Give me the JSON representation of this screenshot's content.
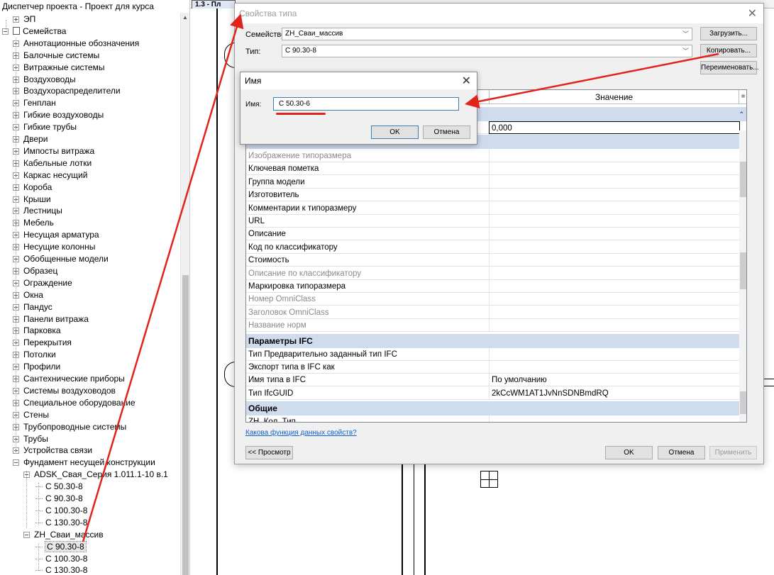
{
  "browser": {
    "title": "Диспетчер проекта - Проект для курса",
    "rows": [
      {
        "label": "ЭП",
        "indent": 18,
        "exp": "plus"
      },
      {
        "label": "Семейства",
        "indent": 3,
        "exp": "minus",
        "icon": true
      },
      {
        "label": "Аннотационные обозначения",
        "indent": 18,
        "exp": "plus"
      },
      {
        "label": "Балочные системы",
        "indent": 18,
        "exp": "plus"
      },
      {
        "label": "Витражные системы",
        "indent": 18,
        "exp": "plus"
      },
      {
        "label": "Воздуховоды",
        "indent": 18,
        "exp": "plus"
      },
      {
        "label": "Воздухораспределители",
        "indent": 18,
        "exp": "plus"
      },
      {
        "label": "Генплан",
        "indent": 18,
        "exp": "plus"
      },
      {
        "label": "Гибкие воздуховоды",
        "indent": 18,
        "exp": "plus"
      },
      {
        "label": "Гибкие трубы",
        "indent": 18,
        "exp": "plus"
      },
      {
        "label": "Двери",
        "indent": 18,
        "exp": "plus"
      },
      {
        "label": "Импосты витража",
        "indent": 18,
        "exp": "plus"
      },
      {
        "label": "Кабельные лотки",
        "indent": 18,
        "exp": "plus"
      },
      {
        "label": "Каркас несущий",
        "indent": 18,
        "exp": "plus"
      },
      {
        "label": "Короба",
        "indent": 18,
        "exp": "plus"
      },
      {
        "label": "Крыши",
        "indent": 18,
        "exp": "plus"
      },
      {
        "label": "Лестницы",
        "indent": 18,
        "exp": "plus"
      },
      {
        "label": "Мебель",
        "indent": 18,
        "exp": "plus"
      },
      {
        "label": "Несущая арматура",
        "indent": 18,
        "exp": "plus"
      },
      {
        "label": "Несущие колонны",
        "indent": 18,
        "exp": "plus"
      },
      {
        "label": "Обобщенные модели",
        "indent": 18,
        "exp": "plus"
      },
      {
        "label": "Образец",
        "indent": 18,
        "exp": "plus"
      },
      {
        "label": "Ограждение",
        "indent": 18,
        "exp": "plus"
      },
      {
        "label": "Окна",
        "indent": 18,
        "exp": "plus"
      },
      {
        "label": "Пандус",
        "indent": 18,
        "exp": "plus"
      },
      {
        "label": "Панели витража",
        "indent": 18,
        "exp": "plus"
      },
      {
        "label": "Парковка",
        "indent": 18,
        "exp": "plus"
      },
      {
        "label": "Перекрытия",
        "indent": 18,
        "exp": "plus"
      },
      {
        "label": "Потолки",
        "indent": 18,
        "exp": "plus"
      },
      {
        "label": "Профили",
        "indent": 18,
        "exp": "plus"
      },
      {
        "label": "Сантехнические приборы",
        "indent": 18,
        "exp": "plus"
      },
      {
        "label": "Системы воздуховодов",
        "indent": 18,
        "exp": "plus"
      },
      {
        "label": "Специальное оборудование",
        "indent": 18,
        "exp": "plus"
      },
      {
        "label": "Стены",
        "indent": 18,
        "exp": "plus"
      },
      {
        "label": "Трубопроводные системы",
        "indent": 18,
        "exp": "plus"
      },
      {
        "label": "Трубы",
        "indent": 18,
        "exp": "plus"
      },
      {
        "label": "Устройства связи",
        "indent": 18,
        "exp": "plus"
      },
      {
        "label": "Фундамент несущей конструкции",
        "indent": 18,
        "exp": "minus"
      },
      {
        "label": "ADSK_Свая_Серия 1.011.1-10 в.1",
        "indent": 33,
        "exp": "minus"
      },
      {
        "label": "С 50.30-8",
        "indent": 50,
        "exp": "leaf"
      },
      {
        "label": "С 90.30-8",
        "indent": 50,
        "exp": "leaf"
      },
      {
        "label": "С 100.30-8",
        "indent": 50,
        "exp": "leaf"
      },
      {
        "label": "С 130.30-8",
        "indent": 50,
        "exp": "leaf"
      },
      {
        "label": "ZH_Сваи_массив",
        "indent": 33,
        "exp": "minus"
      },
      {
        "label": "С 90.30-8",
        "indent": 50,
        "exp": "leaf",
        "selected": true
      },
      {
        "label": "С 100.30-8",
        "indent": 50,
        "exp": "leaf"
      },
      {
        "label": "С 130.30-8",
        "indent": 50,
        "exp": "leaf"
      }
    ]
  },
  "view_tab": {
    "label": "1.3 - Пл"
  },
  "type_dialog": {
    "title": "Свойства типа",
    "family_label": "Семейство:",
    "family_value": "ZH_Сваи_массив",
    "type_label": "Тип:",
    "type_value": "С 90.30-8",
    "load_button": "Загрузить...",
    "duplicate_button": "Копировать...",
    "rename_button": "Переименовать...",
    "value_header": "Значение",
    "first_value": "0,000",
    "rows": [
      {
        "kind": "param",
        "name": "Изображение типоразмера",
        "value": "",
        "gray": true
      },
      {
        "kind": "param",
        "name": "Ключевая пометка",
        "value": ""
      },
      {
        "kind": "param",
        "name": "Группа модели",
        "value": ""
      },
      {
        "kind": "param",
        "name": "Изготовитель",
        "value": ""
      },
      {
        "kind": "param",
        "name": "Комментарии к типоразмеру",
        "value": ""
      },
      {
        "kind": "param",
        "name": "URL",
        "value": ""
      },
      {
        "kind": "param",
        "name": "Описание",
        "value": ""
      },
      {
        "kind": "param",
        "name": "Код по классификатору",
        "value": ""
      },
      {
        "kind": "param",
        "name": "Стоимость",
        "value": ""
      },
      {
        "kind": "param",
        "name": "Описание по классификатору",
        "value": "",
        "gray": true
      },
      {
        "kind": "param",
        "name": "Маркировка типоразмера",
        "value": ""
      },
      {
        "kind": "param",
        "name": "Номер OmniClass",
        "value": "",
        "gray": true
      },
      {
        "kind": "param",
        "name": "Заголовок OmniClass",
        "value": "",
        "gray": true
      },
      {
        "kind": "param",
        "name": "Название норм",
        "value": "",
        "gray": true
      },
      {
        "kind": "group",
        "name": "Параметры IFC"
      },
      {
        "kind": "param",
        "name": "Тип Предварительно заданный тип IFC",
        "value": ""
      },
      {
        "kind": "param",
        "name": "Экспорт типа в IFC как",
        "value": ""
      },
      {
        "kind": "param",
        "name": "Имя типа в IFC",
        "value": "По умолчанию"
      },
      {
        "kind": "param",
        "name": "Тип IfcGUID",
        "value": "2kCcWM1AT1JvNnSDNBmdRQ"
      },
      {
        "kind": "group",
        "name": "Общие"
      },
      {
        "kind": "param",
        "name": "ZH_Кол_Тип",
        "value": ""
      }
    ],
    "help_link": "Какова функция данных свойств?",
    "preview_button": "<< Просмотр",
    "ok_button": "OK",
    "cancel_button": "Отмена",
    "apply_button": "Применить"
  },
  "name_dialog": {
    "title": "Имя",
    "name_label": "Имя:",
    "name_value": "С 50.30-6",
    "ok_button": "OK",
    "cancel_button": "Отмена"
  },
  "colors": {
    "group_header": "#cfdcee",
    "annotation": "#e2231a",
    "focus_border": "#3c7fb1",
    "link": "#0b63ce"
  }
}
